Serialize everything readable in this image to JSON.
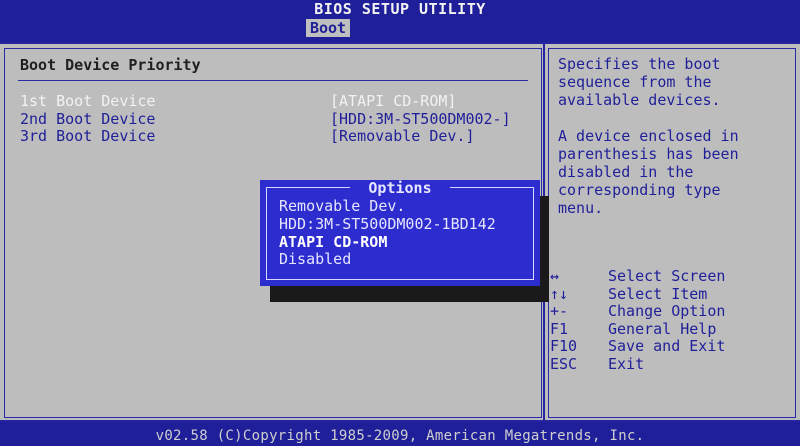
{
  "title": "BIOS SETUP UTILITY",
  "active_tab": "Boot",
  "section_title": "Boot Device Priority",
  "boot_devices": [
    {
      "label": "1st Boot Device",
      "value": "[ATAPI CD-ROM]",
      "selected": true
    },
    {
      "label": "2nd Boot Device",
      "value": "[HDD:3M-ST500DM002-]",
      "selected": false
    },
    {
      "label": "3rd Boot Device",
      "value": "[Removable Dev.]",
      "selected": false
    }
  ],
  "help": {
    "p1": "Specifies the boot\nsequence from the\navailable devices.",
    "p2": "A device enclosed in\nparenthesis has been\ndisabled in the\ncorresponding type\nmenu."
  },
  "keys": [
    {
      "key": "↔",
      "desc": "Select Screen"
    },
    {
      "key": "↑↓",
      "desc": "Select Item"
    },
    {
      "key": "+-",
      "desc": "Change Option"
    },
    {
      "key": "F1",
      "desc": "General Help"
    },
    {
      "key": "F10",
      "desc": "Save and Exit"
    },
    {
      "key": "ESC",
      "desc": "Exit"
    }
  ],
  "options_popup": {
    "title": "Options",
    "items": [
      {
        "label": "Removable Dev.",
        "selected": false
      },
      {
        "label": "HDD:3M-ST500DM002-1BD142",
        "selected": false
      },
      {
        "label": "ATAPI CD-ROM",
        "selected": true
      },
      {
        "label": "Disabled",
        "selected": false
      }
    ]
  },
  "footer": "v02.58 (C)Copyright 1985-2009, American Megatrends, Inc.",
  "colors": {
    "bios_blue": "#1f1f99",
    "panel_gray": "#bdbdbd",
    "popup_blue": "#2c2ccf"
  }
}
